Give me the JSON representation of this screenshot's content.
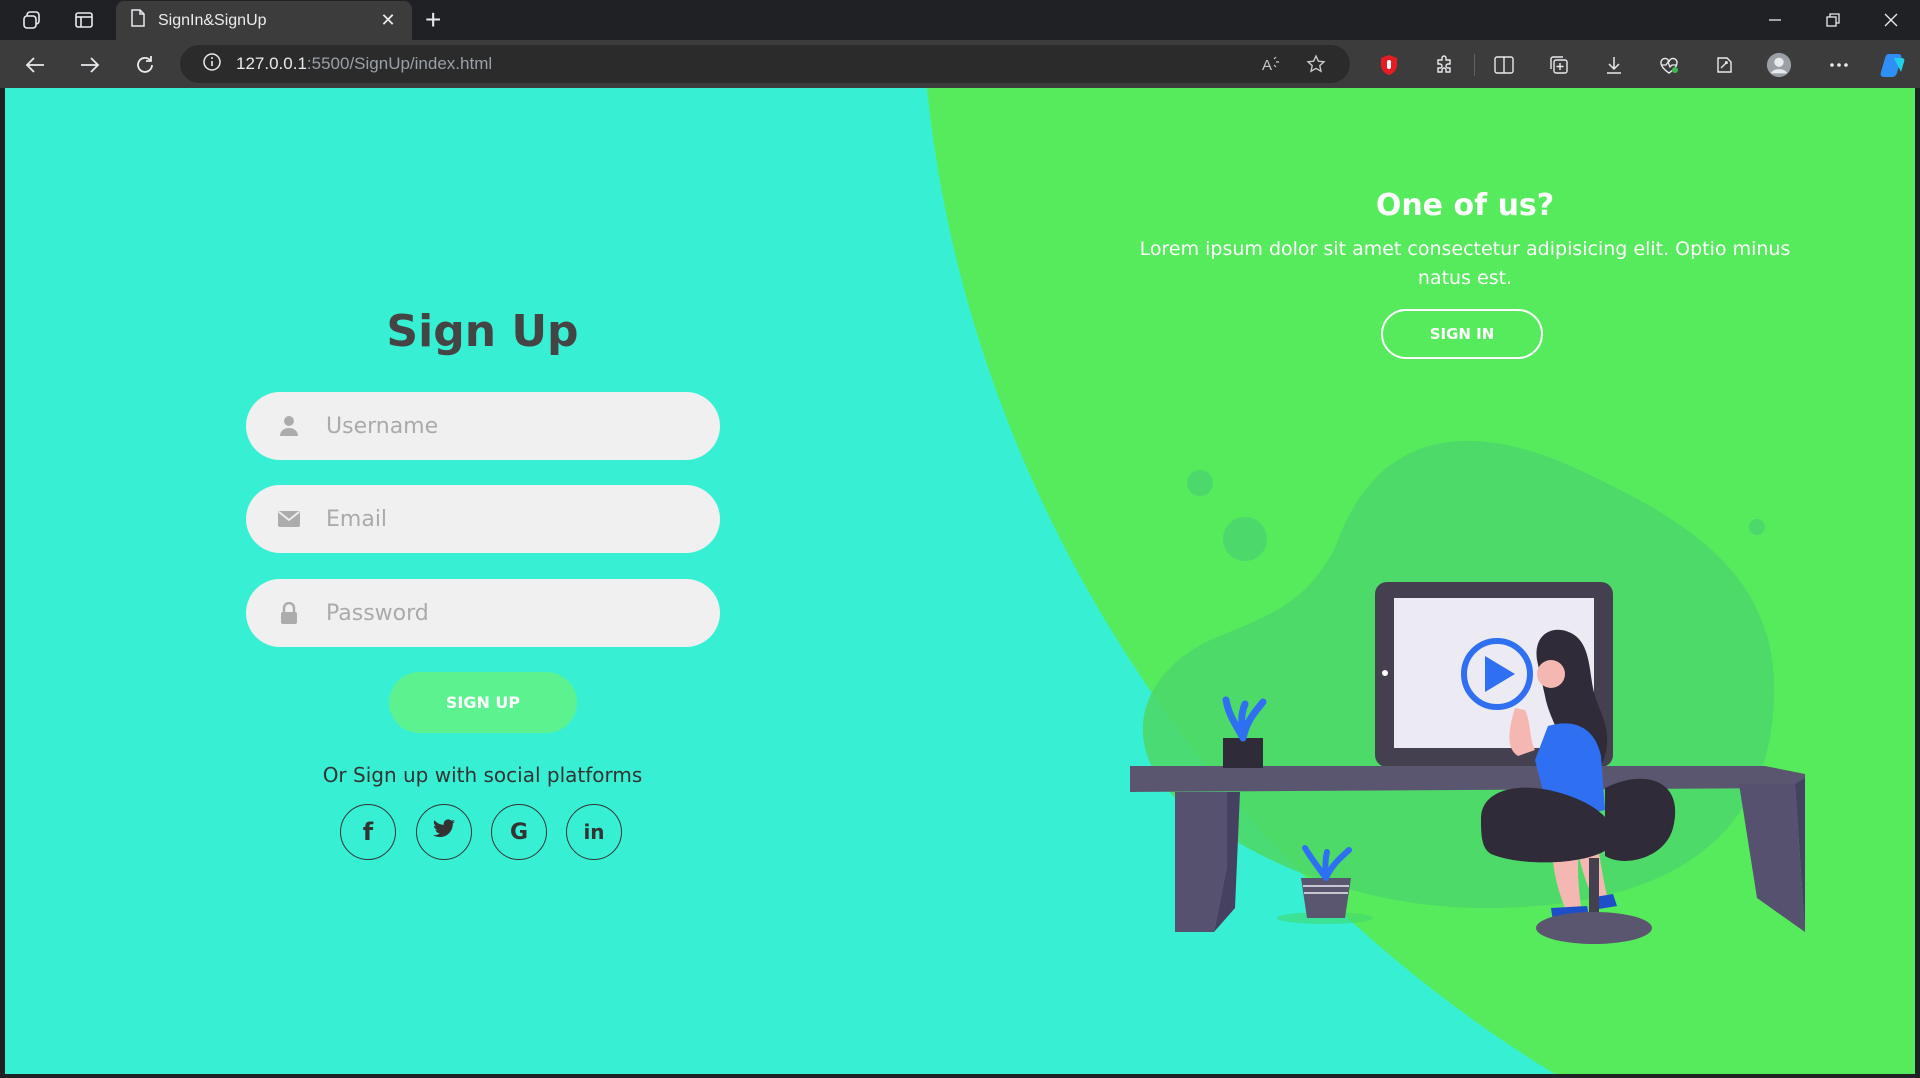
{
  "browser": {
    "tab_title": "SignIn&SignUp",
    "url_host": "127.0.0.1",
    "url_rest": ":5500/SignUp/index.html"
  },
  "signup": {
    "title": "Sign Up",
    "username_placeholder": "Username",
    "email_placeholder": "Email",
    "password_placeholder": "Password",
    "button_label": "SIGN UP",
    "social_text": "Or Sign up with social platforms",
    "social": [
      {
        "name": "facebook-icon",
        "glyph": "f"
      },
      {
        "name": "twitter-icon",
        "glyph": ""
      },
      {
        "name": "google-icon",
        "glyph": "G"
      },
      {
        "name": "linkedin-icon",
        "glyph": "in"
      }
    ]
  },
  "panel": {
    "title": "One of us?",
    "text": "Lorem ipsum dolor sit amet consectetur adipisicing elit. Optio minus natus est.",
    "button_label": "SIGN IN"
  },
  "colors": {
    "left_background": "#37f0d4",
    "right_background": "#56eb5c",
    "signup_button": "#5cf28f",
    "field_background": "#f0f0f0"
  }
}
